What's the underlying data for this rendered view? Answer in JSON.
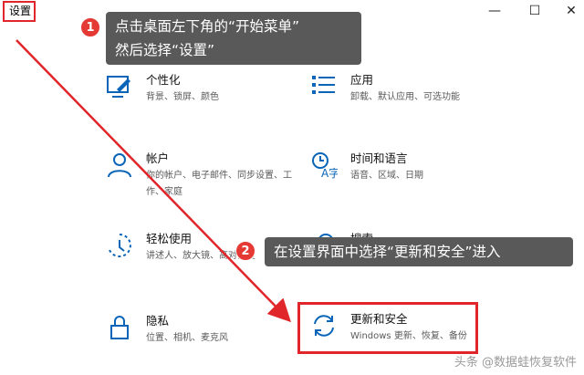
{
  "window": {
    "title": "设置",
    "controls": {
      "minimize": "—",
      "maximize": "☐",
      "close": "✕"
    }
  },
  "tiles": [
    {
      "title": "个性化",
      "desc": "背景、锁屏、颜色",
      "icon": "personalization-icon"
    },
    {
      "title": "应用",
      "desc": "卸载、默认应用、可选功能",
      "icon": "apps-icon"
    },
    {
      "title": "帐户",
      "desc": "你的帐户、电子邮件、同步设置、工作、家庭",
      "icon": "account-icon"
    },
    {
      "title": "时间和语言",
      "desc": "语音、区域、日期",
      "icon": "time-language-icon"
    },
    {
      "title": "轻松使用",
      "desc": "讲述人、放大镜、高对比度",
      "icon": "ease-of-access-icon"
    },
    {
      "title": "搜索",
      "desc": "",
      "icon": "search-icon"
    },
    {
      "title": "隐私",
      "desc": "位置、相机、麦克风",
      "icon": "lock-icon"
    },
    {
      "title": "更新和安全",
      "desc": "Windows 更新、恢复、备份",
      "icon": "update-icon"
    }
  ],
  "callouts": [
    {
      "number": "1",
      "text_lines": [
        "点击桌面左下角的“开始菜单”",
        "然后选择“设置”"
      ]
    },
    {
      "number": "2",
      "text_lines": [
        "在设置界面中选择“更新和安全”进入"
      ]
    }
  ],
  "watermark": "头条 @数据蛙恢复软件",
  "colors": {
    "accent": "#0a64b8",
    "annotation_red": "#e0262b",
    "callout_bg": "#595959",
    "badge": "#e53935"
  }
}
